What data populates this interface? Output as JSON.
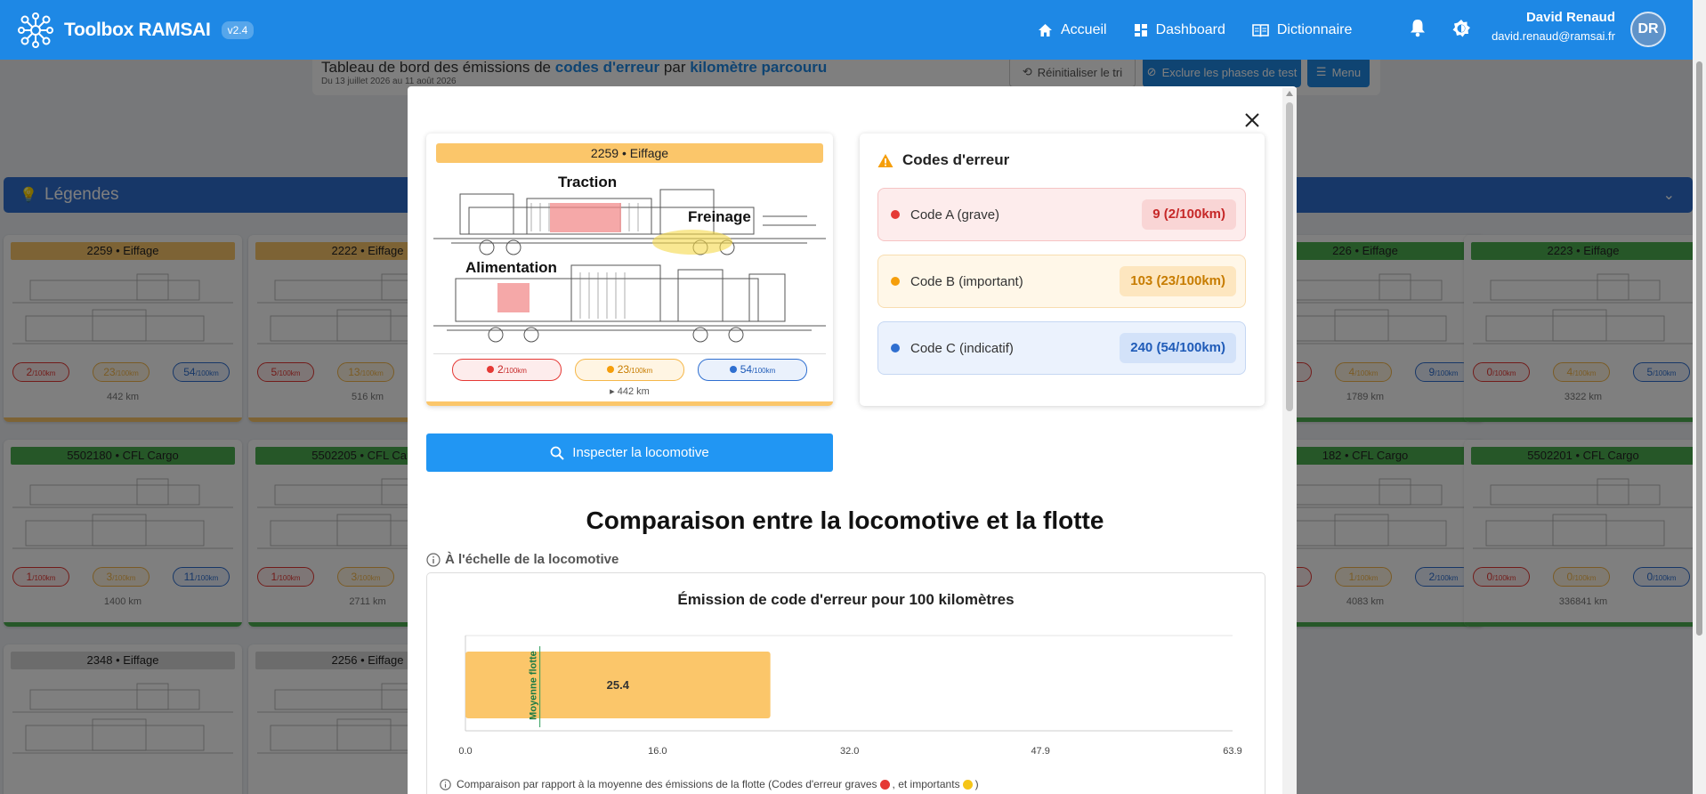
{
  "app": {
    "name": "Toolbox RAMSAI",
    "version": "v2.4"
  },
  "nav": {
    "items": [
      {
        "label": "Accueil"
      },
      {
        "label": "Dashboard"
      },
      {
        "label": "Dictionnaire"
      }
    ]
  },
  "user": {
    "name": "David Renaud",
    "email": "david.renaud@ramsai.fr",
    "initials": "DR"
  },
  "page": {
    "title_part1": "Tableau de bord des émissions de",
    "title_hl1": "codes d'erreur",
    "title_part2": "par",
    "title_hl2": "kilomètre parcouru",
    "subtitle": "Du 13 juillet 2026 au 11 août 2026",
    "reset_label": "Réinitialiser le tri",
    "exclude_label": "Exclure les phases de test",
    "menu_label": "Menu",
    "legend_label": "Légendes"
  },
  "background_cards": [
    {
      "title": "2259 • Eiffage",
      "a": "2",
      "b": "23",
      "c": "54",
      "km": "442 km",
      "color": "#fbc66a"
    },
    {
      "title": "2222 • Eiffage",
      "a": "5",
      "b": "13",
      "c": "",
      "km": "516 km",
      "color": "#fbc66a"
    },
    {
      "title": "226 • Eiffage",
      "a": "",
      "b": "4",
      "c": "9",
      "km": "1789 km",
      "color": "#4caf50"
    },
    {
      "title": "2223 • Eiffage",
      "a": "0",
      "b": "4",
      "c": "5",
      "km": "3322 km",
      "color": "#4caf50"
    },
    {
      "title": "5502180 • CFL Cargo",
      "a": "1",
      "b": "3",
      "c": "11",
      "km": "1400 km",
      "color": "#4caf50"
    },
    {
      "title": "5502205 • CFL Cargo",
      "a": "1",
      "b": "3",
      "c": "",
      "km": "2711 km",
      "color": "#4caf50"
    },
    {
      "title": "182 • CFL Cargo",
      "a": "",
      "b": "1",
      "c": "2",
      "km": "4083 km",
      "color": "#4caf50"
    },
    {
      "title": "5502201 • CFL Cargo",
      "a": "0",
      "b": "0",
      "c": "0",
      "km": "336841 km",
      "color": "#4caf50"
    },
    {
      "title": "2348 • Eiffage",
      "a": "",
      "b": "",
      "c": "",
      "km": "",
      "color": "#d9d9d9"
    },
    {
      "title": "2256 • Eiffage",
      "a": "",
      "b": "",
      "c": "",
      "km": "",
      "color": "#d9d9d9"
    }
  ],
  "unit_short": "/100km",
  "modal": {
    "loco": {
      "title": "2259 • Eiffage",
      "zones": {
        "traction": "Traction",
        "freinage": "Freinage",
        "alimentation": "Alimentation"
      },
      "pill_a": "2",
      "pill_b": "23",
      "pill_c": "54",
      "unit": "/100km",
      "km": "442 km"
    },
    "inspect_label": "Inspecter la locomotive",
    "codes": {
      "title": "Codes d'erreur",
      "rows": [
        {
          "label": "Code A (grave)",
          "value": "9 (2/100km)",
          "color": "#e53935"
        },
        {
          "label": "Code B (important)",
          "value": "103 (23/100km)",
          "color": "#f59e0b"
        },
        {
          "label": "Code C (indicatif)",
          "value": "240 (54/100km)",
          "color": "#2f6fd0"
        }
      ]
    },
    "comparison_title": "Comparaison entre la locomotive et la flotte",
    "scale_label": "À l'échelle de la locomotive",
    "note_text": "Comparaison par rapport à la moyenne des émissions de la flotte (Codes d'erreur graves",
    "note_mid": ", et importants",
    "note_end": ")"
  },
  "chart_data": {
    "type": "bar",
    "orientation": "horizontal",
    "title": "Émission de code d'erreur pour 100 kilomètres",
    "values": [
      25.4
    ],
    "value_labels": [
      "25.4"
    ],
    "xlim": [
      0.0,
      63.9
    ],
    "xticks": [
      "0.0",
      "16.0",
      "32.0",
      "47.9",
      "63.9"
    ],
    "reference_line": {
      "label": "Moyenne flotte",
      "value": 6.2
    },
    "bar_color": "#fbc66a",
    "reference_color": "#2e9d5b"
  }
}
